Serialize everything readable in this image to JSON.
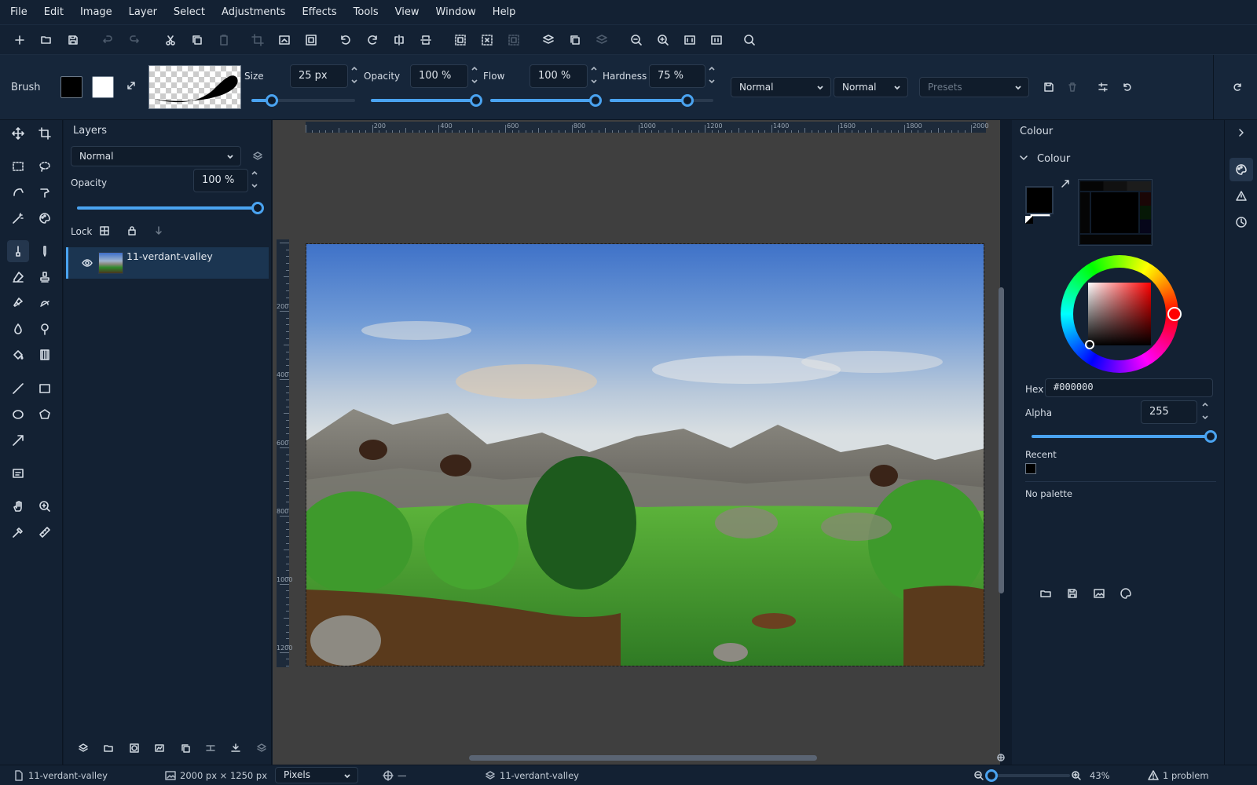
{
  "menu": [
    "File",
    "Edit",
    "Image",
    "Layer",
    "Select",
    "Adjustments",
    "Effects",
    "Tools",
    "View",
    "Window",
    "Help"
  ],
  "tool_options": {
    "tool_name": "Brush",
    "size_label": "Size",
    "size_value": "25 px",
    "size_level": 0.2,
    "opacity_label": "Opacity",
    "opacity_value": "100 %",
    "opacity_level": 1.0,
    "flow_label": "Flow",
    "flow_value": "100 %",
    "flow_level": 1.0,
    "hardness_label": "Hardness",
    "hardness_value": "75 %",
    "hardness_level": 0.75,
    "blend_mode_1": "Normal",
    "blend_mode_2": "Normal",
    "presets_placeholder": "Presets",
    "primary_color": "#000000",
    "secondary_color": "#ffffff"
  },
  "layers_panel": {
    "title": "Layers",
    "blend_mode": "Normal",
    "opacity_label": "Opacity",
    "opacity_value": "100 %",
    "opacity_level": 1.0,
    "lock_label": "Lock",
    "layers": [
      {
        "name": "11-verdant-valley",
        "visible": true
      }
    ]
  },
  "rulers": {
    "horizontal": [
      "200",
      "400",
      "600",
      "800",
      "1000",
      "1200",
      "1400",
      "1600",
      "1800",
      "2000"
    ],
    "vertical": [
      "200",
      "400",
      "600",
      "800",
      "1000",
      "1200"
    ]
  },
  "colour_panel": {
    "panel_title": "Colour",
    "section_title": "Colour",
    "hex_label": "Hex",
    "hex_value": "#000000",
    "alpha_label": "Alpha",
    "alpha_value": "255",
    "alpha_level": 1.0,
    "recent_label": "Recent",
    "recent_colors": [
      "#000000"
    ],
    "palette_text": "No palette",
    "hue_color": "#ff0000"
  },
  "status": {
    "document": "11-verdant-valley",
    "dimensions": "2000 px × 1250 px",
    "units": "Pixels",
    "cursor_pos": "—",
    "active_layer": "11-verdant-valley",
    "zoom": "43%",
    "zoom_level": 0.43,
    "problems": "1 problem"
  },
  "accent_color": "#4aa3f0"
}
